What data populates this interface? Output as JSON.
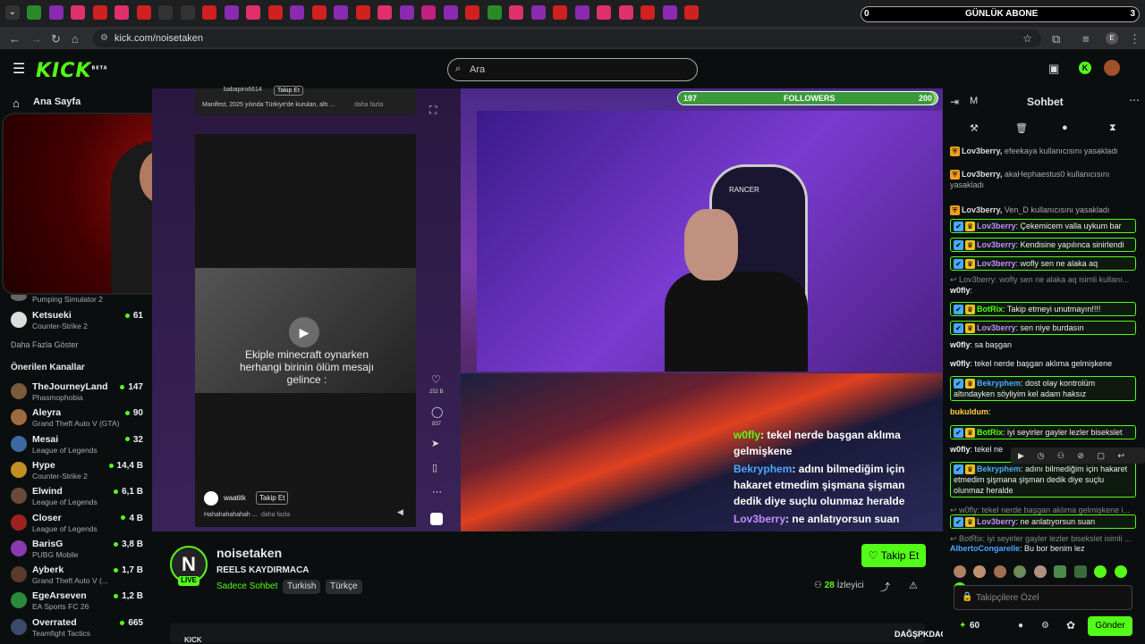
{
  "browser": {
    "url": "kick.com/noisetaken",
    "gunluk_count": "0",
    "gunluk_label": "GÜNLÜK ABONE",
    "gunluk_goal": "3"
  },
  "header": {
    "logo": "KICK",
    "logo_beta": "BETA",
    "search_placeholder": "Ara"
  },
  "sidebar": {
    "home": "Ana Sayfa",
    "followed_partial": [
      {
        "name": "",
        "game": "Pumping Simulator 2",
        "viewers": ""
      },
      {
        "name": "Ketsueki",
        "game": "Counter-Strike 2",
        "viewers": "61"
      }
    ],
    "show_more": "Daha Fazla Göster",
    "recommended_title": "Önerilen Kanallar",
    "recommended": [
      {
        "name": "TheJourneyLand",
        "game": "Phasmophobia",
        "viewers": "147",
        "color": "#7a5a3a"
      },
      {
        "name": "Aleyra",
        "game": "Grand Theft Auto V (GTA)",
        "viewers": "90",
        "color": "#a06a40"
      },
      {
        "name": "Mesai",
        "game": "League of Legends",
        "viewers": "32",
        "color": "#3a6aa0"
      },
      {
        "name": "Hype",
        "game": "Counter-Strike 2",
        "viewers": "14,4 B",
        "color": "#c09020"
      },
      {
        "name": "Elwind",
        "game": "League of Legends",
        "viewers": "6,1 B",
        "color": "#6a4a3a"
      },
      {
        "name": "Closer",
        "game": "League of Legends",
        "viewers": "4 B",
        "color": "#a02020"
      },
      {
        "name": "BarisG",
        "game": "PUBG Mobile",
        "viewers": "3,8 B",
        "color": "#8a3ab0"
      },
      {
        "name": "Ayberk",
        "game": "Grand Theft Auto V (...",
        "viewers": "1,7 B",
        "color": "#5a3a2a"
      },
      {
        "name": "EgeArseven",
        "game": "EA Sports FC 26",
        "viewers": "1,2 B",
        "color": "#2a8a3a"
      },
      {
        "name": "Overrated",
        "game": "Teamfight Tactics",
        "viewers": "665",
        "color": "#3a4a6a"
      }
    ]
  },
  "stream": {
    "top_post_user": "babapiro6614",
    "top_post_follow": "Takip Et",
    "top_post_text": "Manifest, 2025 yılında Türkiye'de kurulan, altı ...",
    "top_post_more": "daha fazla",
    "reel_caption": "Ekiple minecraft oynarken herhangi birinin ölüm mesajı gelince :",
    "reel_user": "waatitk",
    "reel_follow": "Takip Et",
    "reel_text": "Hahahahahahah ...",
    "reel_more": "daha fazla",
    "likes": "252 B",
    "comments": "837",
    "followers_label": "FOLLOWERS",
    "followers_current": "197",
    "followers_goal": "200",
    "followers_progress": 0.985,
    "overlay_chat": [
      {
        "user": "w0fly",
        "text": ": tekel nerde başgan aklıma gelmişkene"
      },
      {
        "user": "Bekryphem",
        "text": ": adını bilmediğim için hakaret etmedim şişmana şişman dedik diye suçlu olunmaz heralde"
      },
      {
        "user": "Lov3berry",
        "text": ": ne anlatıyorsun suan"
      }
    ]
  },
  "channel": {
    "initial": "N",
    "live": "LIVE",
    "name": "noisetaken",
    "title": "REELS KAYDIRMACA",
    "category": "Sadece Sohbet",
    "tags": [
      "Turkish",
      "Türkçe"
    ],
    "follow_button": "Takip Et",
    "viewers": "28",
    "viewers_label": "İzleyici",
    "bottom_title_partial": "KICK"
  },
  "chat": {
    "title": "Sohbet",
    "mode_letter": "M",
    "messages": [
      {
        "type": "sys",
        "user": "Lov3berry,",
        "text": " efeekaya kullanıcısını yasakladı"
      },
      {
        "type": "sys",
        "user": "Lov3berry,",
        "text": " akaHephaestus0 kullanıcısını yasakladı"
      },
      {
        "type": "sys",
        "user": "Lov3berry,",
        "text": " Ven_D kullanıcısını yasakladı"
      },
      {
        "type": "hl",
        "user": "Lov3berry",
        "color": "#c48cff",
        "text": ": Çekemicem valla uykum bar"
      },
      {
        "type": "hl",
        "user": "Lov3berry",
        "color": "#c48cff",
        "text": ": Kendisine yapılınca sinirlendi"
      },
      {
        "type": "hl",
        "user": "Lov3berry",
        "color": "#c48cff",
        "text": ": wofly sen ne alaka aq"
      },
      {
        "type": "reply",
        "user": "",
        "text": "Lov3berry: wofly sen ne alaka aq isimli kullanı..."
      },
      {
        "type": "normal",
        "user": "w0fly",
        "color": "#eee",
        "text": ":"
      },
      {
        "type": "hl",
        "user": "BotRix",
        "color": "#53fc18",
        "text": ": Takip etmeyi unutmayın!!!!"
      },
      {
        "type": "hl",
        "user": "Lov3berry",
        "color": "#c48cff",
        "text": ": sen niye burdasın"
      },
      {
        "type": "normal",
        "user": "w0fly",
        "color": "#eee",
        "text": ": sa başgan"
      },
      {
        "type": "normal",
        "user": "w0fly",
        "color": "#eee",
        "text": ": tekel nerde başgan aklıma gelmişkene"
      },
      {
        "type": "hl",
        "user": "Bekryphem",
        "color": "#4aa8ff",
        "text": ": dost olay kontrolüm altındayken söyliyim kel adam haksız"
      },
      {
        "type": "normal",
        "user": "bukuldum",
        "color": "#ffd040",
        "text": ":"
      },
      {
        "type": "hl",
        "user": "BotRix",
        "color": "#53fc18",
        "text": ": iyi seyirler gayler lezler bisekslet"
      },
      {
        "type": "normal",
        "user": "w0fly",
        "color": "#eee",
        "text": ": tekel ne"
      },
      {
        "type": "hl",
        "user": "Bekryphem",
        "color": "#4aa8ff",
        "text": ": adını bilmediğim için hakaret etmedim şişmana şişman dedik diye suçlu olunmaz heralde"
      },
      {
        "type": "reply",
        "user": "",
        "text": "w0fly: tekel nerde başgan aklıma gelmişkene i..."
      },
      {
        "type": "hl",
        "user": "Lov3berry",
        "color": "#c48cff",
        "text": ": ne anlatıyorsun suan"
      },
      {
        "type": "reply",
        "user": "",
        "text": "BotRix: iyi seyirler gayler lezler bisekslet isimli ..."
      },
      {
        "type": "normal",
        "user": "AlbertoCongarelle",
        "color": "#4aa8ff",
        "text": ": Bu bor benim lez"
      }
    ],
    "input_placeholder": "Takipçilere Özel",
    "points": "60",
    "send": "Gönder",
    "ticker": "DAĞŞPKDAGSDKAGSOG"
  }
}
